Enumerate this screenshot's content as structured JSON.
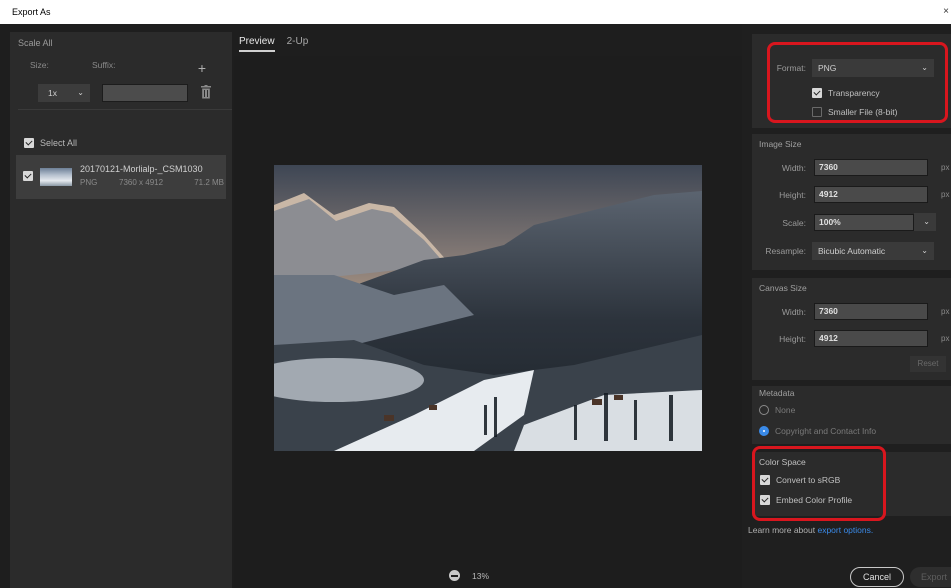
{
  "window": {
    "title": "Export As",
    "close_glyph": "×"
  },
  "scale": {
    "title": "Scale All",
    "size_label": "Size:",
    "suffix_label": "Suffix:",
    "size_value": "1x",
    "suffix_value": ""
  },
  "assets": {
    "select_all_label": "Select All",
    "select_all_checked": true,
    "items": [
      {
        "name": "20170121-Morlialp-_CSM1030",
        "format": "PNG",
        "dims": "7360 x 4912",
        "size": "71.2 MB",
        "checked": true
      }
    ]
  },
  "preview": {
    "tabs": [
      {
        "label": "Preview",
        "active": true
      },
      {
        "label": "2-Up",
        "active": false
      }
    ],
    "zoom": "13%"
  },
  "file_settings": {
    "format_label": "Format:",
    "format_value": "PNG",
    "transparency_label": "Transparency",
    "transparency_checked": true,
    "smaller_file_label": "Smaller File (8-bit)",
    "smaller_file_checked": false
  },
  "image_size": {
    "title": "Image Size",
    "width_label": "Width:",
    "width_value": "7360",
    "height_label": "Height:",
    "height_value": "4912",
    "scale_label": "Scale:",
    "scale_value": "100%",
    "resample_label": "Resample:",
    "resample_value": "Bicubic Automatic",
    "unit": "px"
  },
  "canvas_size": {
    "title": "Canvas Size",
    "width_label": "Width:",
    "width_value": "7360",
    "height_label": "Height:",
    "height_value": "4912",
    "unit": "px",
    "reset_label": "Reset"
  },
  "metadata": {
    "title": "Metadata",
    "options": [
      {
        "label": "None",
        "selected": false
      },
      {
        "label": "Copyright and Contact Info",
        "selected": true
      }
    ]
  },
  "color_space": {
    "title": "Color Space",
    "convert_label": "Convert to sRGB",
    "convert_checked": true,
    "embed_label": "Embed Color Profile",
    "embed_checked": true
  },
  "footer": {
    "learn_text": "Learn more about ",
    "learn_link": "export options.",
    "cancel_label": "Cancel",
    "export_label": "Export"
  },
  "colors": {
    "accent": "#3a8ae8",
    "highlight": "#d8161e",
    "panel": "#2b2b2b",
    "background": "#1e1e1e"
  }
}
